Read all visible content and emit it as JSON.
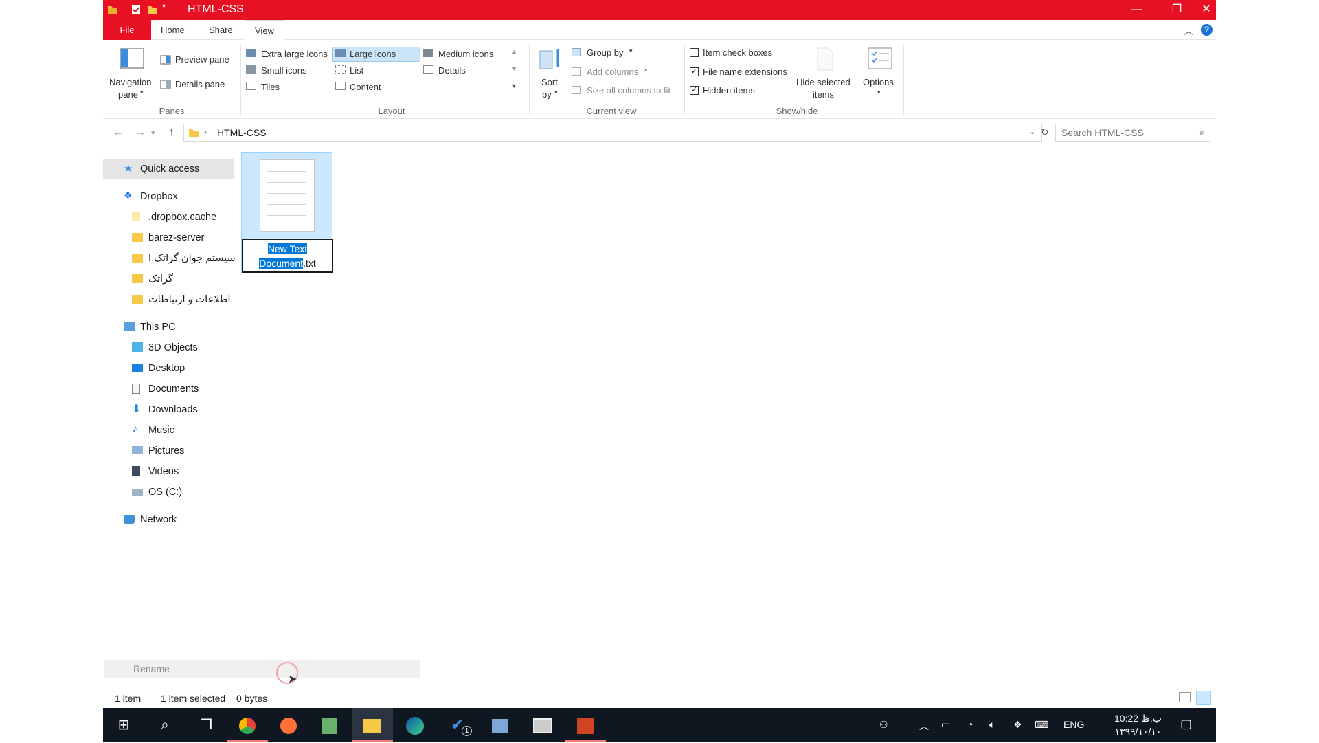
{
  "window": {
    "title": "HTML-CSS",
    "minimize_icon": "minimize-icon",
    "maximize_icon": "restore-icon",
    "close_icon": "close-icon"
  },
  "tabs": {
    "file": "File",
    "home": "Home",
    "share": "Share",
    "view": "View"
  },
  "ribbon": {
    "panes": {
      "navigation_pane": "Navigation",
      "navigation_pane_2": "pane",
      "preview_pane": "Preview pane",
      "details_pane": "Details pane",
      "group": "Panes"
    },
    "layout": {
      "extra_large_icons": "Extra large icons",
      "large_icons": "Large icons",
      "medium_icons": "Medium icons",
      "small_icons": "Small icons",
      "list": "List",
      "details": "Details",
      "tiles": "Tiles",
      "content": "Content",
      "group": "Layout",
      "selected": "Large icons"
    },
    "current_view": {
      "sort_by": "Sort",
      "sort_by_2": "by",
      "group_by": "Group by",
      "add_columns": "Add columns",
      "size_all_columns": "Size all columns to fit",
      "group": "Current view"
    },
    "show_hide": {
      "item_check_boxes": "Item check boxes",
      "item_check_boxes_checked": false,
      "file_name_extensions": "File name extensions",
      "file_name_extensions_checked": true,
      "hidden_items": "Hidden items",
      "hidden_items_checked": true,
      "hide_selected": "Hide selected",
      "hide_selected_2": "items",
      "group": "Show/hide"
    },
    "options": "Options"
  },
  "address": {
    "path": "HTML-CSS",
    "search_placeholder": "Search HTML-CSS"
  },
  "nav_pane": {
    "quick_access": "Quick access",
    "dropbox": "Dropbox",
    "dropbox_items": [
      ".dropbox.cache",
      "barez-server",
      "سیستم جوان گراتک ا",
      "گراتک",
      "اطلاعات و ارتباطات"
    ],
    "this_pc": "This PC",
    "pc_items": [
      "3D Objects",
      "Desktop",
      "Documents",
      "Downloads",
      "Music",
      "Pictures",
      "Videos",
      "OS (C:)"
    ],
    "network": "Network"
  },
  "file": {
    "name_selected": "New Text",
    "name_selected_2": "Document",
    "extension": ".txt"
  },
  "rename_hint": "Rename",
  "status": {
    "count": "1 item",
    "selected": "1 item selected",
    "size": "0 bytes"
  },
  "taskbar": {
    "language": "ENG",
    "time": "10:22 ب.ظ",
    "date": "۱۳۹۹/۱۰/۱۰",
    "badge": "1"
  },
  "colors": {
    "accent": "#e81123",
    "selection": "#cce8ff",
    "text_highlight": "#0078d7",
    "taskbar": "#0f1720"
  }
}
